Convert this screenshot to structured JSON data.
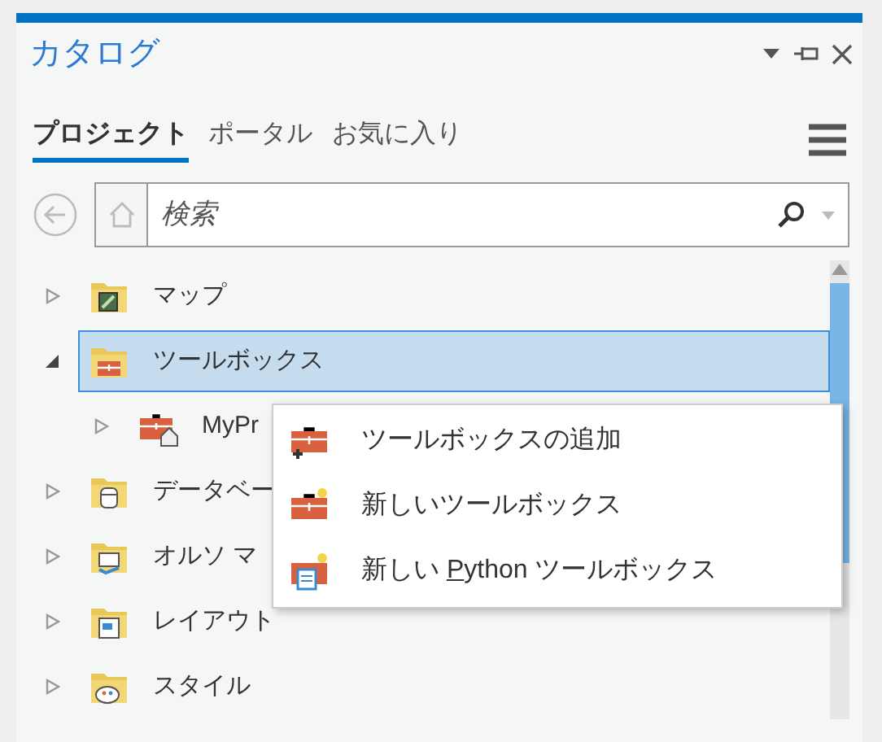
{
  "window": {
    "title": "カタログ"
  },
  "tabs": [
    {
      "label": "プロジェクト",
      "selected": true
    },
    {
      "label": "ポータル",
      "selected": false
    },
    {
      "label": "お気に入り",
      "selected": false
    }
  ],
  "search": {
    "placeholder": "検索"
  },
  "tree": [
    {
      "label": "マップ",
      "kind": "map",
      "expanded": false,
      "selected": false
    },
    {
      "label": "ツールボックス",
      "kind": "toolbox",
      "expanded": true,
      "selected": true,
      "children": [
        {
          "label": "MyPr",
          "kind": "projecttoolbox",
          "expanded": false,
          "selected": false
        }
      ]
    },
    {
      "label": "データベー",
      "kind": "database",
      "expanded": false,
      "selected": false
    },
    {
      "label": "オルソ マ",
      "kind": "imagery",
      "expanded": false,
      "selected": false
    },
    {
      "label": "レイアウト",
      "kind": "layout",
      "expanded": false,
      "selected": false
    },
    {
      "label": "スタイル",
      "kind": "style",
      "expanded": false,
      "selected": false
    }
  ],
  "context_menu": [
    {
      "label": "ツールボックスの追加",
      "kind": "add"
    },
    {
      "label": "新しいツールボックス",
      "kind": "new"
    },
    {
      "label_before": "新しい ",
      "access_key": "P",
      "label_after": "ython ツールボックス",
      "kind": "python"
    }
  ]
}
